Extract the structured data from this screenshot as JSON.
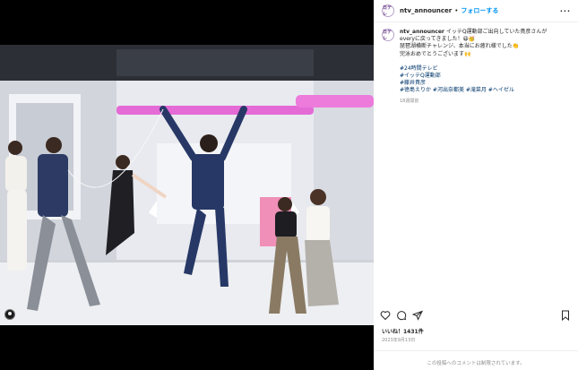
{
  "post": {
    "username": "ntv_announcer",
    "follow_label": "フォローする",
    "avatar_text": "日テレ",
    "caption_lines": [
      "イッテQ運動部ご出向していた貴彦さんが",
      "everyに戻ってきました！😆🥳",
      "琵琶湖横断チャレンジ、本当にお疲れ様でした👏",
      "完泳おめでとうございます🙌"
    ],
    "hashtags": [
      "#24時間テレビ",
      "#イッテQ運動部",
      "#藤井貴彦",
      "#徳島えりか #河出奈都美 #滝菜月 #ヘイゼル"
    ],
    "time_ago": "18週間前",
    "likes": "いいね！1431件",
    "date": "2023年9月13日",
    "comment_placeholder": "この投稿へのコメントは制限されています。"
  },
  "colors": {
    "follow": "#0095f6",
    "hashtag": "#00376b",
    "studio_pink": "#e46ad6"
  },
  "icons": [
    "user-tag-icon",
    "heart-icon",
    "comment-icon",
    "share-icon",
    "bookmark-icon",
    "more-options-icon"
  ]
}
